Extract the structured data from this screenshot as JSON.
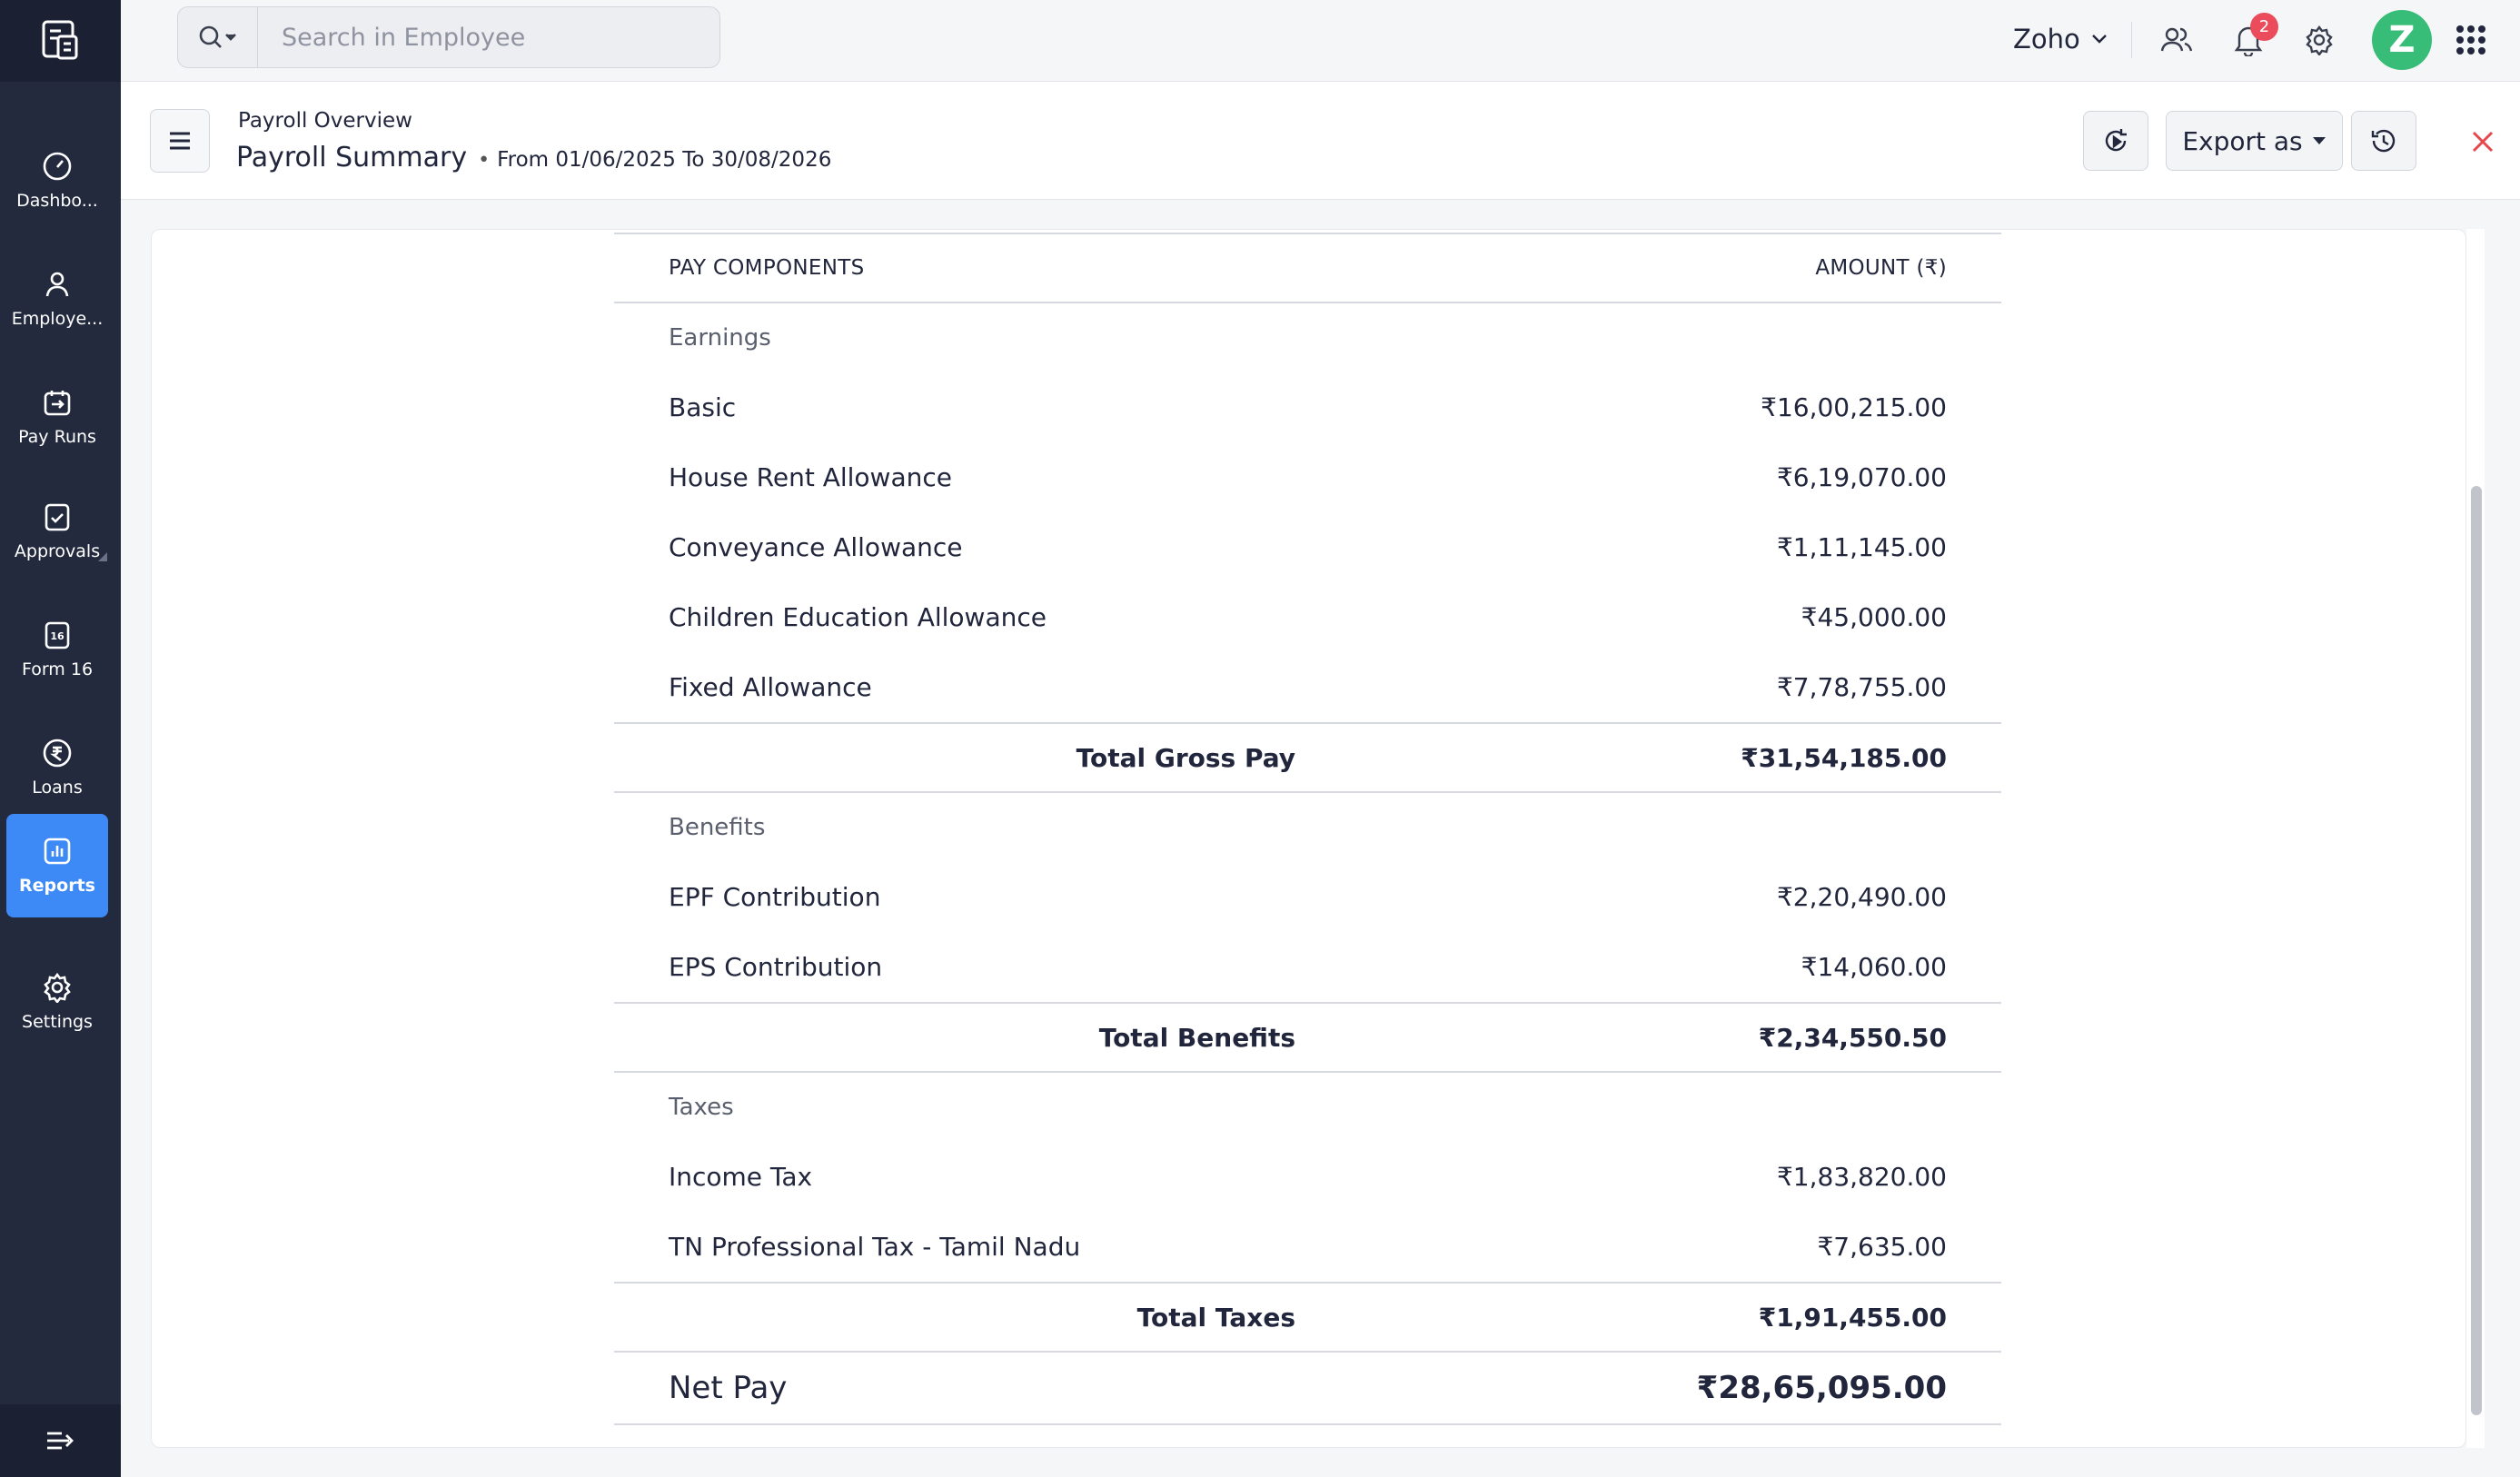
{
  "sidebar": {
    "items": [
      {
        "label": "Dashbo...",
        "icon": "dashboard-gauge-icon"
      },
      {
        "label": "Employe...",
        "icon": "employee-person-icon"
      },
      {
        "label": "Pay Runs",
        "icon": "pay-runs-icon"
      },
      {
        "label": "Approvals",
        "icon": "approvals-check-icon"
      },
      {
        "label": "Form 16",
        "icon": "form16-icon"
      },
      {
        "label": "Loans",
        "icon": "rupee-coin-icon"
      },
      {
        "label": "Reports",
        "icon": "reports-chart-icon",
        "active": true
      },
      {
        "label": "Settings",
        "icon": "gear-icon"
      }
    ],
    "form16_badge": "16"
  },
  "topbar": {
    "search_placeholder": "Search in Employee",
    "org_name": "Zoho",
    "notification_count": "2",
    "avatar_letter": "Z"
  },
  "report": {
    "breadcrumb": "Payroll Overview",
    "title": "Payroll Summary",
    "separator": "•",
    "range": "From 01/06/2025 To 30/08/2026",
    "export_label": "Export as"
  },
  "table": {
    "headers": {
      "component": "PAY COMPONENTS",
      "amount": "AMOUNT (₹)"
    },
    "earnings": {
      "label": "Earnings",
      "items": [
        {
          "name": "Basic",
          "amount": "₹16,00,215.00"
        },
        {
          "name": "House Rent Allowance",
          "amount": "₹6,19,070.00"
        },
        {
          "name": "Conveyance Allowance",
          "amount": "₹1,11,145.00"
        },
        {
          "name": "Children Education Allowance",
          "amount": "₹45,000.00"
        },
        {
          "name": "Fixed Allowance",
          "amount": "₹7,78,755.00"
        }
      ],
      "total_label": "Total Gross Pay",
      "total_amount": "₹31,54,185.00"
    },
    "benefits": {
      "label": "Benefits",
      "items": [
        {
          "name": "EPF Contribution",
          "amount": "₹2,20,490.00"
        },
        {
          "name": "EPS Contribution",
          "amount": "₹14,060.00"
        }
      ],
      "total_label": "Total Benefits",
      "total_amount": "₹2,34,550.50"
    },
    "taxes": {
      "label": "Taxes",
      "items": [
        {
          "name": "Income Tax",
          "amount": "₹1,83,820.00"
        },
        {
          "name": "TN Professional Tax - Tamil Nadu",
          "amount": "₹7,635.00"
        }
      ],
      "total_label": "Total Taxes",
      "total_amount": "₹1,91,455.00"
    },
    "net_pay": {
      "label": "Net Pay",
      "amount": "₹28,65,095.00"
    }
  },
  "colors": {
    "sidebar_bg": "#232a3e",
    "active_item": "#3d8af7",
    "badge": "#ea4c5c",
    "avatar": "#37bd77",
    "close": "#e5484d"
  }
}
